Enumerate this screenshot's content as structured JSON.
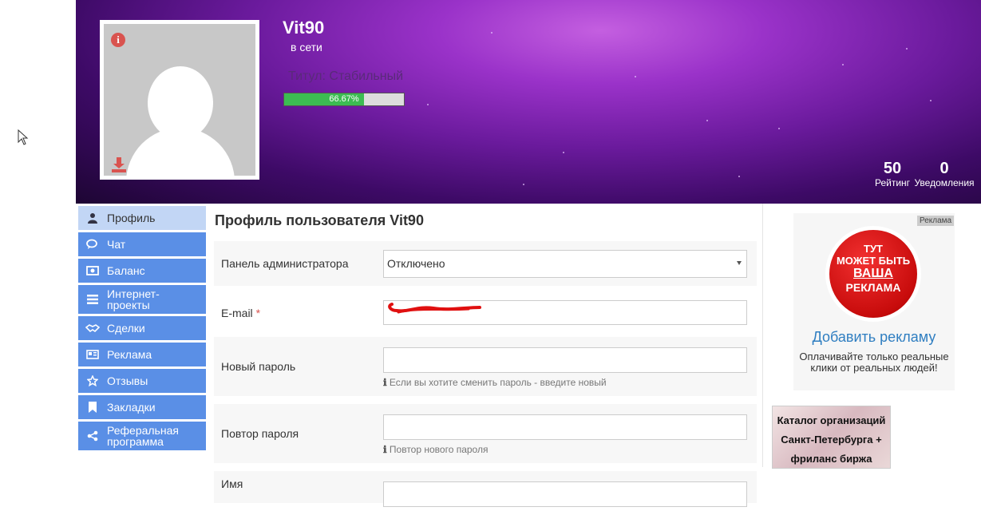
{
  "profile": {
    "username": "Vit90",
    "status": "в сети",
    "title": "Титул: Стабильный",
    "progress_text": "66.67%",
    "progress_value": 66.67,
    "rating_value": "50",
    "rating_label": "Рейтинг",
    "notifications_value": "0",
    "notifications_label": "Уведомления"
  },
  "sidebar": {
    "items": [
      {
        "label": "Профиль",
        "icon": "user-icon",
        "active": true
      },
      {
        "label": "Чат",
        "icon": "chat-icon"
      },
      {
        "label": "Баланс",
        "icon": "money-icon"
      },
      {
        "label": "Интернет-\nпроекты",
        "icon": "list-icon"
      },
      {
        "label": "Сделки",
        "icon": "handshake-icon"
      },
      {
        "label": "Реклама",
        "icon": "newspaper-icon"
      },
      {
        "label": "Отзывы",
        "icon": "star-icon"
      },
      {
        "label": "Закладки",
        "icon": "bookmark-icon"
      },
      {
        "label": "Реферальная\nпрограмма",
        "icon": "share-icon"
      }
    ]
  },
  "main": {
    "title": "Профиль пользователя Vit90",
    "admin_label": "Панель администратора",
    "admin_value": "Отключено",
    "email_label": "E-mail",
    "email_required": "*",
    "new_password_label": "Новый пароль",
    "new_password_hint": "Если вы хотите сменить пароль - введите новый",
    "repeat_password_label": "Повтор пароля",
    "repeat_password_hint": "Повтор нового пароля",
    "name_label": "Имя"
  },
  "ads": {
    "tag": "Реклама",
    "badge_line1": "ТУТ",
    "badge_line2": "МОЖЕТ БЫТЬ",
    "badge_line3": "ВАША",
    "badge_line4": "РЕКЛАМА",
    "add_link": "Добавить рекламу",
    "description": "Оплачивайте только реальные клики от реальных людей!",
    "catalog_text": "Каталог организаций Санкт-Петербурга + фриланс биржа"
  },
  "colors": {
    "nav_bg": "#5a8fe6",
    "nav_active_bg": "#c2d6f5",
    "progress_fill": "#3cbc52",
    "link": "#2f7ec1",
    "required": "#d9534f"
  }
}
